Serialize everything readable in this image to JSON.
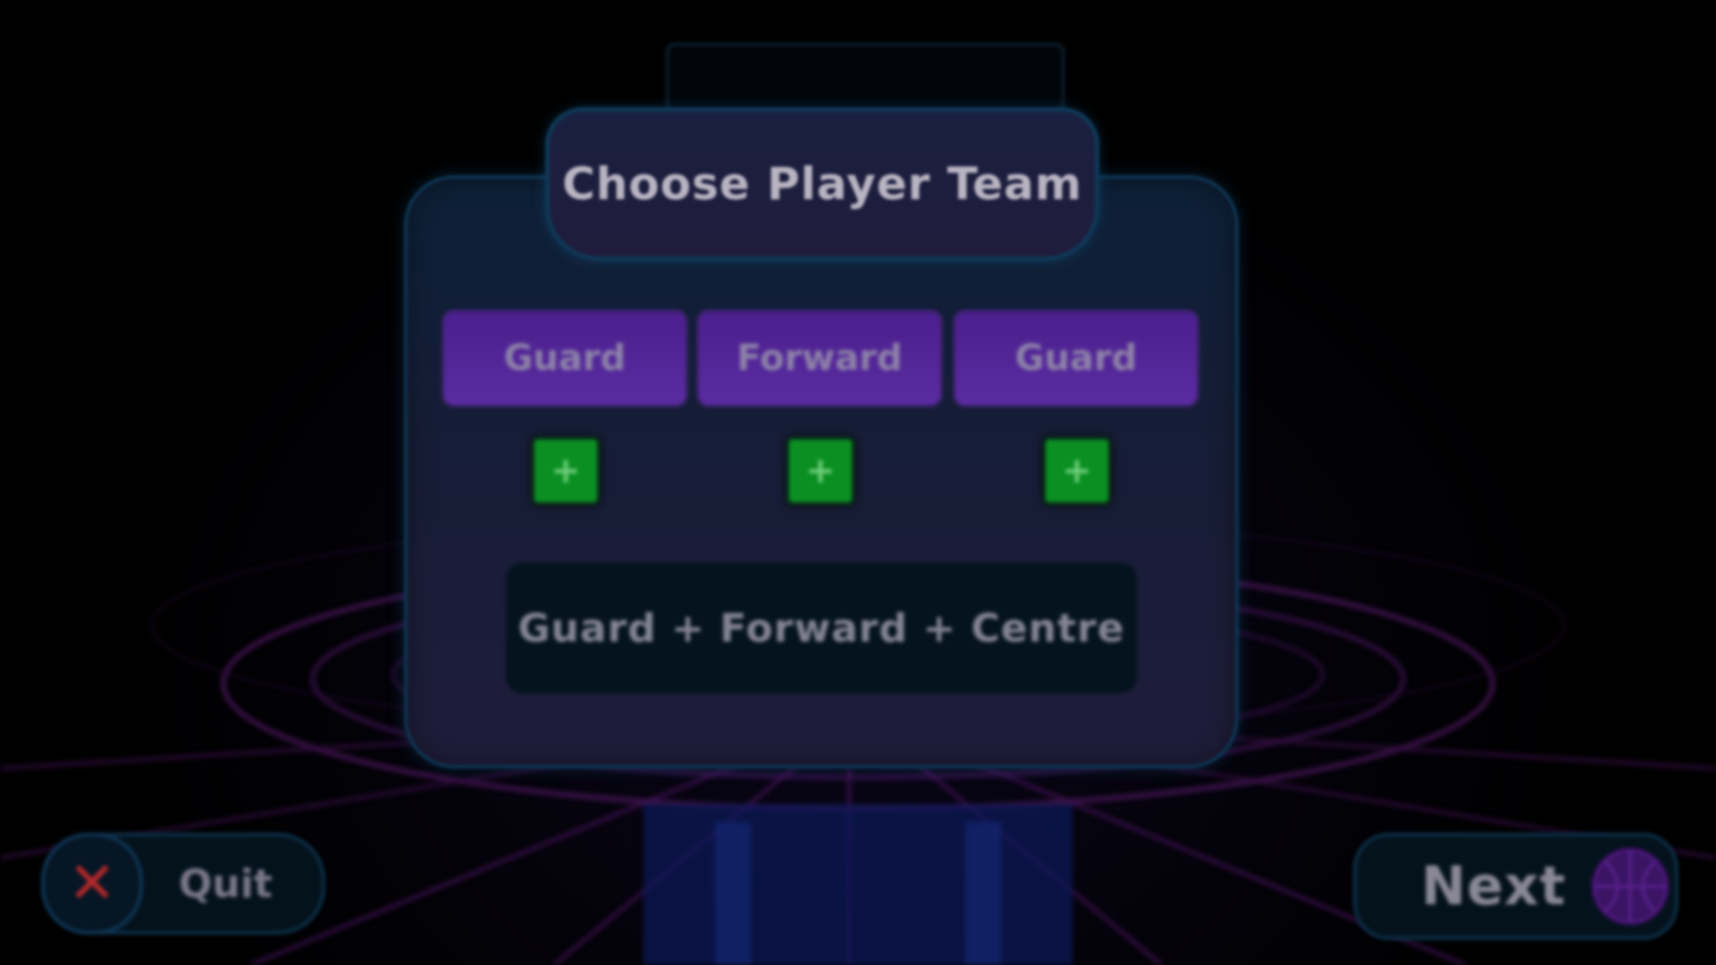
{
  "title": "Choose Player Team",
  "roles": [
    {
      "label": "Guard"
    },
    {
      "label": "Forward"
    },
    {
      "label": "Guard"
    }
  ],
  "add_buttons": [
    {
      "label": "+"
    },
    {
      "label": "+"
    },
    {
      "label": "+"
    }
  ],
  "team_combo": "Guard + Forward + Centre",
  "quit": {
    "label": "Quit",
    "icon": "x-icon"
  },
  "next": {
    "label": "Next",
    "icon": "basketball-icon"
  },
  "colors": {
    "panel_border": "#0e3350",
    "role_button": "#5a2ca2",
    "add_button": "#0b8f22",
    "quit_icon": "#b2282a",
    "grid_neon": "#5a1a6e"
  }
}
